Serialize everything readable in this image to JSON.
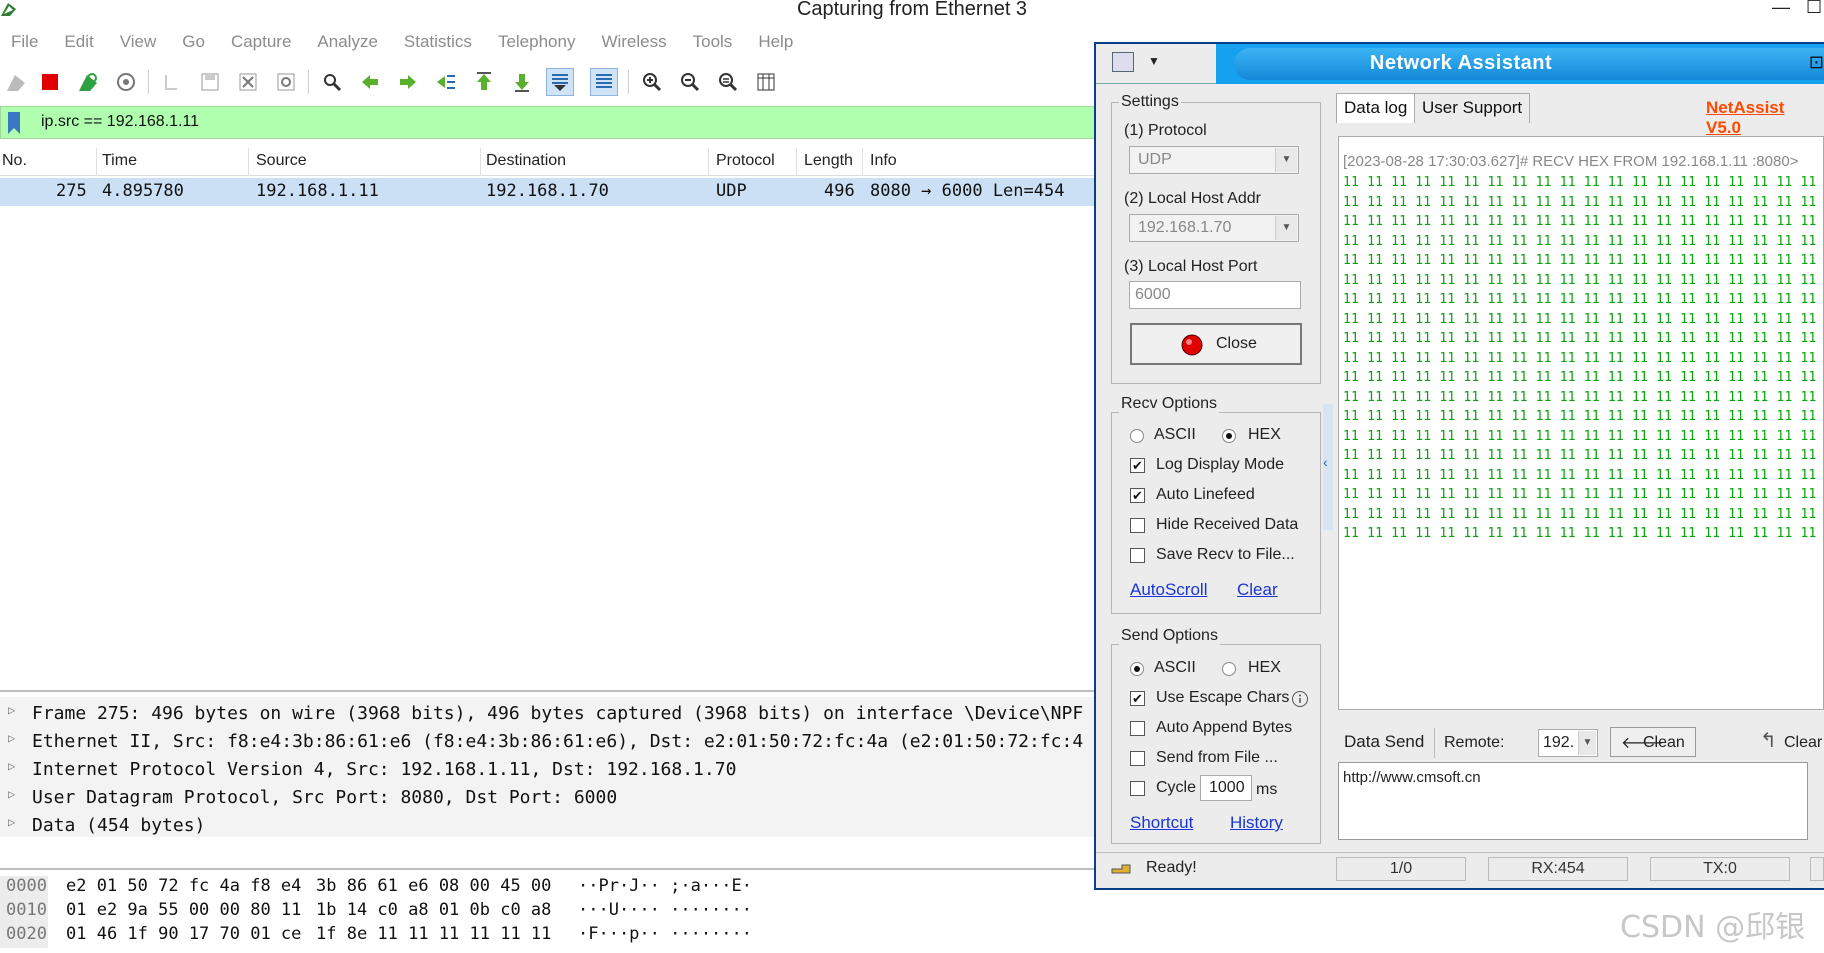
{
  "wireshark": {
    "title": "Capturing from Ethernet 3",
    "minimize": "—",
    "maximize": "☐",
    "menu": [
      "File",
      "Edit",
      "View",
      "Go",
      "Capture",
      "Analyze",
      "Statistics",
      "Telephony",
      "Wireless",
      "Tools",
      "Help"
    ],
    "filter": "ip.src == 192.168.1.11",
    "columns": [
      "No.",
      "Time",
      "Source",
      "Destination",
      "Protocol",
      "Length",
      "Info"
    ],
    "packet": {
      "no": "275",
      "time": "4.895780",
      "source": "192.168.1.11",
      "destination": "192.168.1.70",
      "protocol": "UDP",
      "length": "496",
      "info": "8080 → 6000 Len=454"
    },
    "details": [
      "Frame 275: 496 bytes on wire (3968 bits), 496 bytes captured (3968 bits) on interface \\Device\\NPF",
      "Ethernet II, Src: f8:e4:3b:86:61:e6 (f8:e4:3b:86:61:e6), Dst: e2:01:50:72:fc:4a (e2:01:50:72:fc:4",
      "Internet Protocol Version 4, Src: 192.168.1.11, Dst: 192.168.1.70",
      "User Datagram Protocol, Src Port: 8080, Dst Port: 6000",
      "Data (454 bytes)"
    ],
    "hex": [
      {
        "offset": "0000",
        "bytes1": "e2 01 50 72 fc 4a f8 e4",
        "bytes2": "3b 86 61 e6 08 00 45 00",
        "ascii": "··Pr·J·· ;·a···E·"
      },
      {
        "offset": "0010",
        "bytes1": "01 e2 9a 55 00 00 80 11",
        "bytes2": "1b 14 c0 a8 01 0b c0 a8",
        "ascii": "···U···· ········"
      },
      {
        "offset": "0020",
        "bytes1": "01 46 1f 90 17 70 01 ce",
        "bytes2": "1f 8e 11 11 11 11 11 11",
        "ascii": "·F···p·· ········"
      }
    ]
  },
  "netassist": {
    "title": "Network Assistant",
    "settings": {
      "group": "Settings",
      "protocol_label": "(1) Protocol",
      "protocol_value": "UDP",
      "host_addr_label": "(2) Local Host Addr",
      "host_addr_value": "192.168.1.70",
      "host_port_label": "(3) Local Host Port",
      "host_port_value": "6000",
      "close_button": "Close"
    },
    "recv": {
      "group": "Recv Options",
      "ascii": "ASCII",
      "hex": "HEX",
      "log_display": "Log Display Mode",
      "auto_linefeed": "Auto Linefeed",
      "hide_received": "Hide Received Data",
      "save_recv": "Save Recv to File...",
      "autoscroll": "AutoScroll",
      "clear": "Clear"
    },
    "send": {
      "group": "Send Options",
      "ascii": "ASCII",
      "hex": "HEX",
      "escape": "Use Escape Chars",
      "append": "Auto Append Bytes",
      "from_file": "Send from File ...",
      "cycle": "Cycle",
      "cycle_value": "1000",
      "cycle_unit": "ms",
      "shortcut": "Shortcut",
      "history": "History"
    },
    "tabs": [
      "Data log",
      "User Support"
    ],
    "version_link": "NetAssist V5.0",
    "log_header": "[2023-08-28 17:30:03.627]# RECV HEX FROM 192.168.1.11 :8080>",
    "hex_line": "11 11 11 11 11 11 11 11 11 11 11 11 11 11 11 11 11 11 11 11 11 11 11 11 11 11 11 11 11 11 11 11 11 11",
    "data_send_label": "Data Send",
    "remote_label": "Remote:",
    "remote_value": "192.",
    "clean_button": "Clean",
    "clear_button": "Clear",
    "send_text": "http://www.cmsoft.cn",
    "status": {
      "ready": "Ready!",
      "count": "1/0",
      "rx": "RX:454",
      "tx": "TX:0"
    }
  },
  "watermark": "CSDN @邱银"
}
